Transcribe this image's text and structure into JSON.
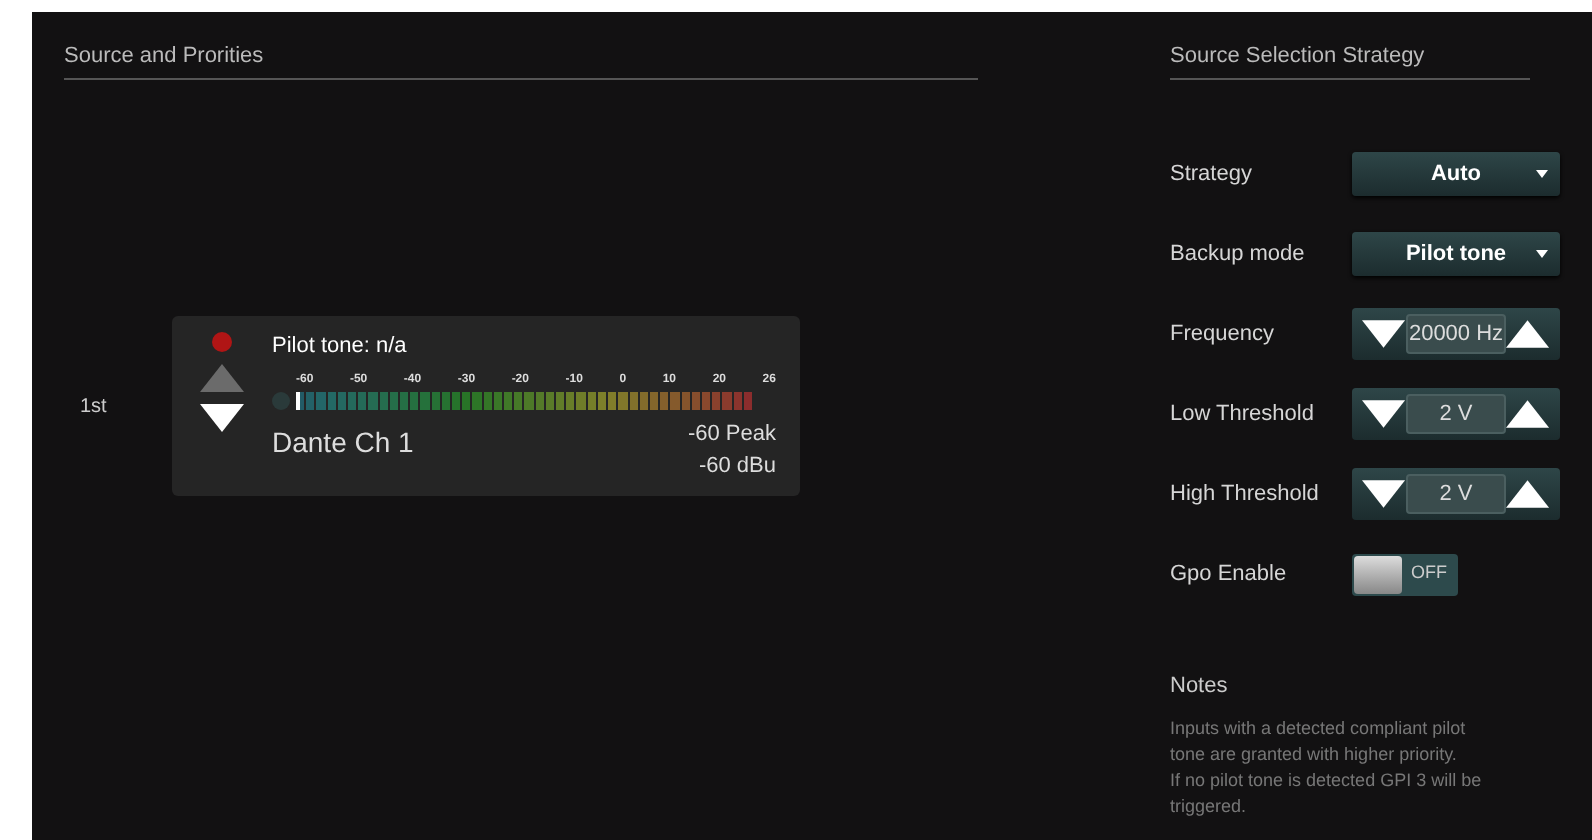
{
  "left_panel": {
    "title": "Source and Prorities"
  },
  "sources": [
    {
      "rank": "1st",
      "pilot_tone": "Pilot tone: n/a",
      "led_on": true,
      "up_disabled": true,
      "down_disabled": false,
      "meter": {
        "ticks": [
          "-60",
          "-50",
          "-40",
          "-30",
          "-20",
          "-10",
          "0",
          "10",
          "20",
          "26"
        ]
      },
      "name": "Dante Ch 1",
      "peak": "-60 Peak",
      "dbu": "-60 dBu"
    }
  ],
  "right_panel": {
    "title": "Source Selection Strategy",
    "settings": [
      {
        "kind": "dropdown",
        "label": "Strategy",
        "value": "Auto"
      },
      {
        "kind": "dropdown",
        "label": "Backup mode",
        "value": "Pilot tone"
      },
      {
        "kind": "stepper",
        "label": "Frequency",
        "value": "20000 Hz"
      },
      {
        "kind": "stepper",
        "label": "Low Threshold",
        "value": "2 V"
      },
      {
        "kind": "stepper",
        "label": "High Threshold",
        "value": "2 V"
      },
      {
        "kind": "toggle",
        "label": "Gpo Enable",
        "on": false,
        "value": "OFF"
      }
    ],
    "notes": {
      "title": "Notes",
      "lines": [
        "Inputs with a detected compliant pilot tone are granted with higher priority.",
        "If no pilot tone is detected GPI 3 will be triggered."
      ]
    }
  }
}
